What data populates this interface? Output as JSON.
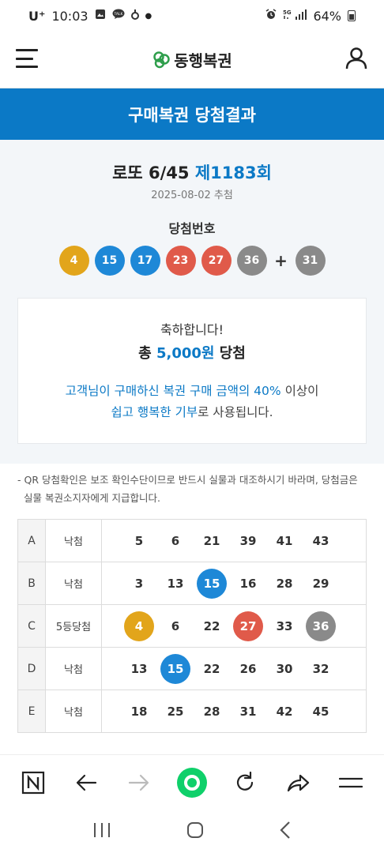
{
  "status_bar": {
    "carrier": "U⁺",
    "time": "10:03",
    "notif_icons": [
      "image-icon",
      "talk-icon",
      "pinwheel-icon"
    ],
    "right_icons": [
      "alarm-icon",
      "5g-signal-icon"
    ],
    "battery": "64%"
  },
  "header": {
    "logo_text": "동행복권",
    "menu_icon": "hamburger-menu-icon",
    "user_icon": "user-icon"
  },
  "banner": {
    "title": "구매복권 당첨결과"
  },
  "draw": {
    "game": "로또 6/45",
    "round": "제1183회",
    "date": "2025-08-02 추첨",
    "winning_label": "당첨번호",
    "winning_numbers": [
      {
        "n": "4",
        "color": "#e2a51b"
      },
      {
        "n": "15",
        "color": "#1e88d7"
      },
      {
        "n": "17",
        "color": "#1e88d7"
      },
      {
        "n": "23",
        "color": "#e05a4a"
      },
      {
        "n": "27",
        "color": "#e05a4a"
      },
      {
        "n": "36",
        "color": "#8a8a8a"
      }
    ],
    "plus": "+",
    "bonus": {
      "n": "31",
      "color": "#8a8a8a"
    }
  },
  "result_card": {
    "congrats": "축하합니다!",
    "total_prefix": "총",
    "total_amount": "5,000원",
    "total_suffix": "당첨",
    "donate_line1_blue": "고객님이 구매하신 복권 구매 금액의 40%",
    "donate_line1_rest": "이상이",
    "donate_line2_blue": "쉽고 행복한 기부",
    "donate_line2_rest": "로 사용됩니다."
  },
  "notice": {
    "line1": "- QR 당첨확인은 보조 확인수단이므로 반드시 실물과 대조하시기 바라며, 당첨금은",
    "line2": "실물 복권소지자에게 지급합니다."
  },
  "tickets": [
    {
      "line": "A",
      "result": "낙첨",
      "numbers": [
        {
          "n": "5"
        },
        {
          "n": "6"
        },
        {
          "n": "21"
        },
        {
          "n": "39"
        },
        {
          "n": "41"
        },
        {
          "n": "43"
        }
      ]
    },
    {
      "line": "B",
      "result": "낙첨",
      "numbers": [
        {
          "n": "3"
        },
        {
          "n": "13"
        },
        {
          "n": "15",
          "hit": "#1e88d7"
        },
        {
          "n": "16"
        },
        {
          "n": "28"
        },
        {
          "n": "29"
        }
      ]
    },
    {
      "line": "C",
      "result": "5등당첨",
      "numbers": [
        {
          "n": "4",
          "hit": "#e2a51b"
        },
        {
          "n": "6"
        },
        {
          "n": "22"
        },
        {
          "n": "27",
          "hit": "#e05a4a"
        },
        {
          "n": "33"
        },
        {
          "n": "36",
          "hit": "#8a8a8a"
        }
      ]
    },
    {
      "line": "D",
      "result": "낙첨",
      "numbers": [
        {
          "n": "13"
        },
        {
          "n": "15",
          "hit": "#1e88d7"
        },
        {
          "n": "22"
        },
        {
          "n": "26"
        },
        {
          "n": "30"
        },
        {
          "n": "32"
        }
      ]
    },
    {
      "line": "E",
      "result": "낙첨",
      "numbers": [
        {
          "n": "18"
        },
        {
          "n": "25"
        },
        {
          "n": "28"
        },
        {
          "n": "31"
        },
        {
          "n": "42"
        },
        {
          "n": "45"
        }
      ]
    }
  ],
  "browser_toolbar": {
    "items": [
      "naver-n-icon",
      "back-arrow-icon",
      "forward-arrow-icon",
      "green-home-icon",
      "refresh-icon",
      "share-icon",
      "menu-icon"
    ]
  },
  "system_nav": {
    "items": [
      "recents-icon",
      "home-icon",
      "back-icon"
    ]
  },
  "colors": {
    "brand_blue": "#0b79c6",
    "ball_yellow": "#e2a51b",
    "ball_blue": "#1e88d7",
    "ball_red": "#e05a4a",
    "ball_gray": "#8a8a8a"
  }
}
